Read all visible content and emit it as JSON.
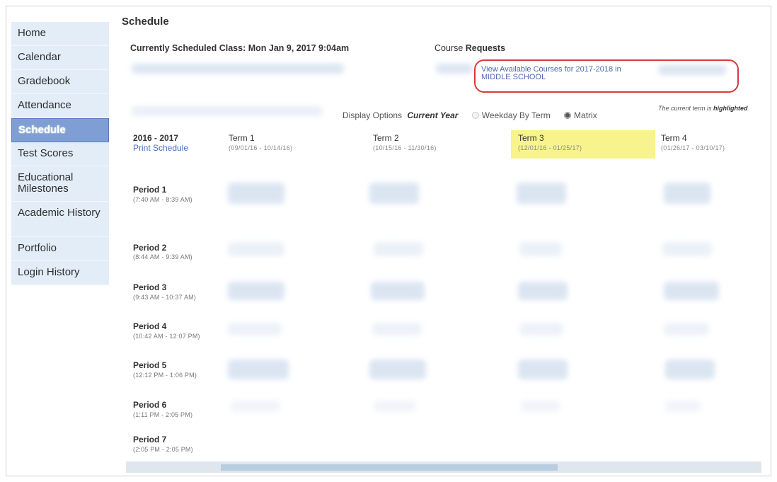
{
  "sidebar": {
    "items": [
      {
        "label": "Home"
      },
      {
        "label": "Calendar"
      },
      {
        "label": "Gradebook"
      },
      {
        "label": "Attendance"
      },
      {
        "label": "Schedule"
      },
      {
        "label": "Test Scores"
      },
      {
        "label": "Educational Milestones"
      },
      {
        "label": "Academic History"
      },
      {
        "label": "Portfolio"
      },
      {
        "label": "Login History"
      }
    ],
    "active": "Schedule"
  },
  "page": {
    "title": "Schedule",
    "scheduled_class": "Currently Scheduled Class: Mon Jan 9, 2017 9:04am",
    "course_label": "Course",
    "requests_label": "Requests",
    "requests_link": "View Available Courses for 2017-2018 in MIDDLE SCHOOL"
  },
  "display": {
    "label": "Display Options",
    "current_year": "Current Year",
    "option_weekday": "Weekday By Term",
    "option_matrix": "Matrix",
    "selected": "Matrix",
    "note_prefix": "The current term is",
    "note_emph": "highlighted"
  },
  "schedule": {
    "year": "2016 - 2017",
    "print": "Print Schedule",
    "terms": [
      {
        "name": "Term 1",
        "dates": "(09/01/16 - 10/14/16)"
      },
      {
        "name": "Term 2",
        "dates": "(10/15/16 - 11/30/16)"
      },
      {
        "name": "Term 3",
        "dates": "(12/01/16 - 01/25/17)",
        "current": true
      },
      {
        "name": "Term 4",
        "dates": "(01/26/17 - 03/10/17)"
      }
    ],
    "periods": [
      {
        "name": "Period 1",
        "time": "(7:40 AM - 8:39 AM)"
      },
      {
        "name": "Period 2",
        "time": "(8:44 AM - 9:39 AM)"
      },
      {
        "name": "Period 3",
        "time": "(9:43 AM - 10:37 AM)"
      },
      {
        "name": "Period 4",
        "time": "(10:42 AM - 12:07 PM)"
      },
      {
        "name": "Period 5",
        "time": "(12:12 PM - 1:06 PM)"
      },
      {
        "name": "Period 6",
        "time": "(1:11 PM - 2:05 PM)"
      },
      {
        "name": "Period 7",
        "time": "(2:05 PM - 2:05 PM)"
      }
    ]
  },
  "colors": {
    "highlight": "#f7f48e",
    "active_nav": "#7f9ed3",
    "nav_bg": "#e3edf8",
    "link": "#4b66b0",
    "annotation": "#d93a3a"
  }
}
